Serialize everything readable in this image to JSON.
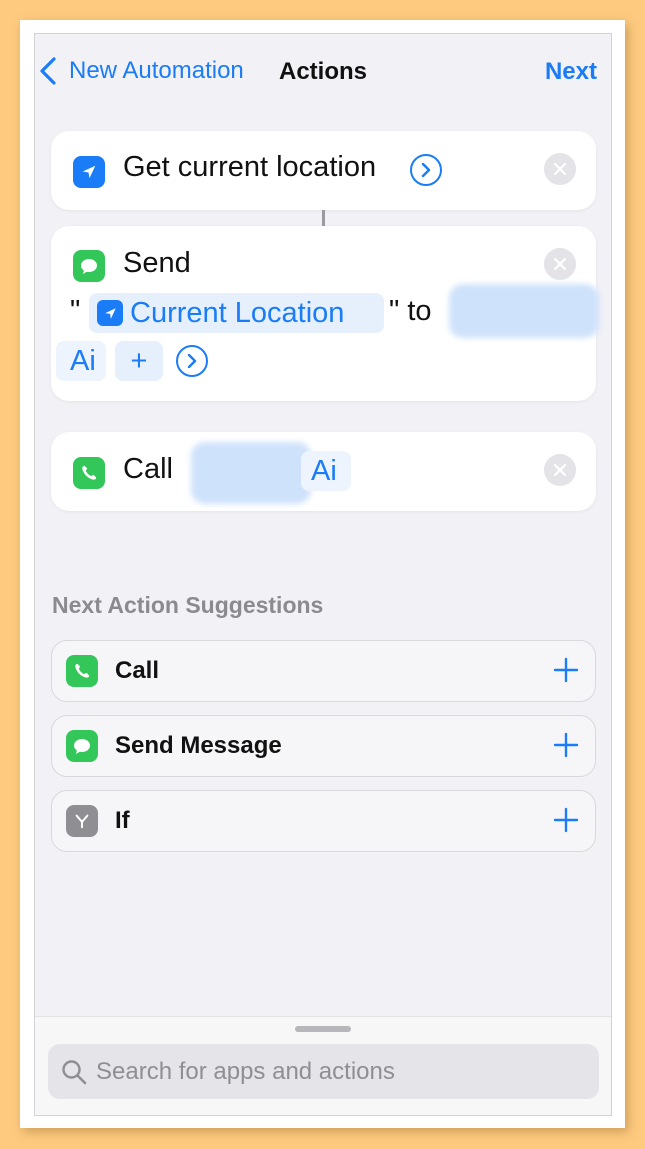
{
  "nav": {
    "back_label": "New Automation",
    "title": "Actions",
    "next_label": "Next"
  },
  "actions": {
    "get_location": {
      "label": "Get current location"
    },
    "send": {
      "label": "Send",
      "quote_open": "\"",
      "token_label": "Current Location",
      "quote_close_to": "\" to",
      "recipient_suffix": "Ai",
      "add_symbol": "+"
    },
    "call": {
      "label": "Call",
      "contact_suffix": "Ai"
    }
  },
  "suggestions": {
    "title": "Next Action Suggestions",
    "items": [
      {
        "label": "Call",
        "icon": "phone-icon"
      },
      {
        "label": "Send Message",
        "icon": "message-icon"
      },
      {
        "label": "If",
        "icon": "branch-icon"
      }
    ]
  },
  "search": {
    "placeholder": "Search for apps and actions"
  },
  "colors": {
    "accent": "#1a7cf6",
    "green": "#33c659",
    "background": "#f1f1f6",
    "frame": "#fdca7f"
  }
}
